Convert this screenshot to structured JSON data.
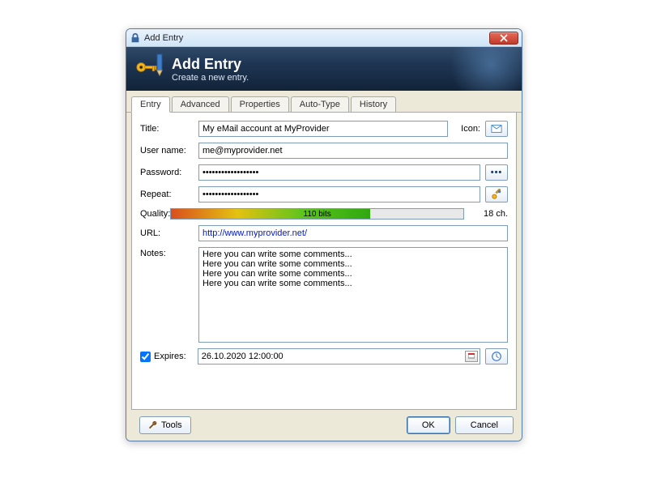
{
  "window": {
    "title": "Add Entry"
  },
  "banner": {
    "heading": "Add Entry",
    "sub": "Create a new entry."
  },
  "tabs": {
    "entry": "Entry",
    "advanced": "Advanced",
    "properties": "Properties",
    "autotype": "Auto-Type",
    "history": "History",
    "active": "entry"
  },
  "labels": {
    "title": "Title:",
    "icon": "Icon:",
    "username": "User name:",
    "password": "Password:",
    "repeat": "Repeat:",
    "quality": "Quality:",
    "url": "URL:",
    "notes": "Notes:",
    "expires": "Expires:"
  },
  "fields": {
    "title": "My eMail account at MyProvider",
    "username": "me@myprovider.net",
    "password": "••••••••••••••••••",
    "repeat": "••••••••••••••••••",
    "url": "http://www.myprovider.net/",
    "notes": "Here you can write some comments...\nHere you can write some comments...\nHere you can write some comments...\nHere you can write some comments...",
    "quality_text": "110 bits",
    "quality_pct": 68,
    "chars": "18 ch.",
    "expires_checked": true,
    "expires_value": "26.10.2020 12:00:00"
  },
  "footer": {
    "tools": "Tools",
    "ok": "OK",
    "cancel": "Cancel"
  }
}
